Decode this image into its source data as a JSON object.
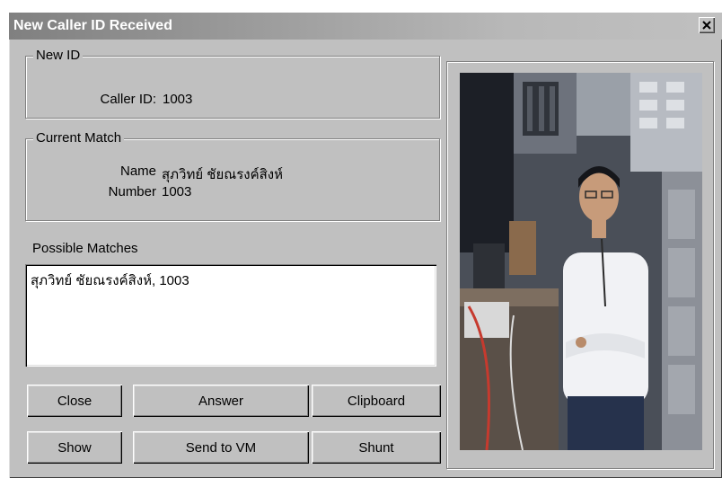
{
  "window": {
    "title": "New Caller ID Received",
    "close_glyph": "×"
  },
  "new_id": {
    "legend": "New ID",
    "caller_id_label": "Caller ID:",
    "caller_id_value": "1003"
  },
  "current_match": {
    "legend": "Current Match",
    "name_label": "Name",
    "name_value": "สุภวิทย์ ชัยณรงค์สิงห์",
    "number_label": "Number",
    "number_value": "1003"
  },
  "possible_matches": {
    "label": "Possible Matches",
    "items": [
      "สุภวิทย์ ชัยณรงค์สิงห์, 1003"
    ]
  },
  "buttons": {
    "close": "Close",
    "answer": "Answer",
    "clipboard": "Clipboard",
    "show": "Show",
    "send_to_vm": "Send to VM",
    "shunt": "Shunt"
  },
  "photo": {
    "icon": "caller-photo"
  }
}
